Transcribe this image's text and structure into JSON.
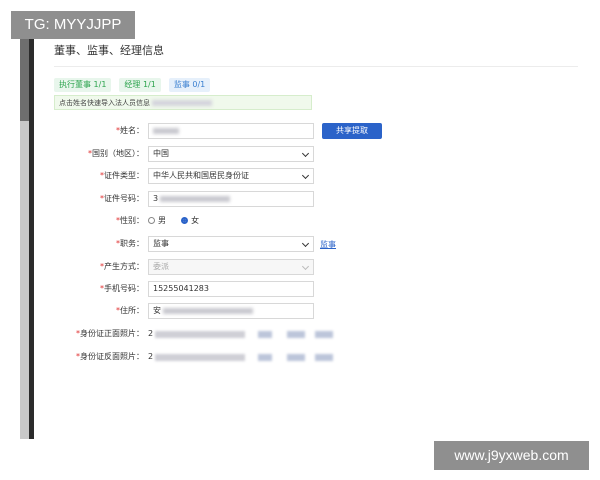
{
  "overlay": {
    "tg_badge": "TG: MYYJJPP",
    "watermark": "www.j9yxweb.com"
  },
  "page": {
    "title": "董事、监事、经理信息"
  },
  "tabs": [
    {
      "label": "执行董事 1/1"
    },
    {
      "label": "经理 1/1"
    },
    {
      "label": "监事 0/1"
    }
  ],
  "tip": {
    "text": "点击姓名快速导入法人员信息"
  },
  "form": {
    "name": {
      "label": "姓名：",
      "required": "*",
      "button": "共享提取"
    },
    "country": {
      "label": "国别（地区）：",
      "required": "*",
      "value": "中国"
    },
    "id_type": {
      "label": "证件类型：",
      "required": "*",
      "value": "中华人民共和国居民身份证"
    },
    "id_number": {
      "label": "证件号码：",
      "required": "*",
      "value": "3"
    },
    "gender": {
      "label": "性别：",
      "required": "*",
      "options": [
        "男",
        "女"
      ],
      "selected": "女"
    },
    "position": {
      "label": "职务：",
      "required": "*",
      "value": "监事",
      "link": "监事"
    },
    "method": {
      "label": "产生方式：",
      "required": "*",
      "value": "委派"
    },
    "phone": {
      "label": "手机号码：",
      "required": "*",
      "value": "15255041283"
    },
    "address": {
      "label": "住所：",
      "required": "*",
      "value": "安"
    },
    "id_front": {
      "label": "身份证正面照片：",
      "required": "*",
      "value": "2"
    },
    "id_back": {
      "label": "身份证反面照片：",
      "required": "*",
      "value": "2"
    }
  },
  "colors": {
    "accent": "#2b63c9",
    "required": "#e03030",
    "tab_green": "#2ea44f",
    "tab_blue": "#3a7fd0"
  }
}
